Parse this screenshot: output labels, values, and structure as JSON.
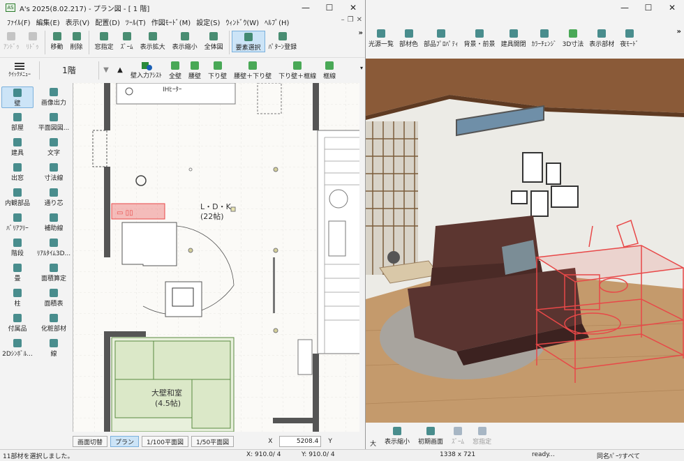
{
  "colors": {
    "accent": "#cce4f7",
    "selection": "#e84848",
    "wall": "#555555",
    "tatami": "#d9e8c8"
  },
  "win3d": {
    "toolbar": [
      {
        "label": "光源一覧",
        "icon": "lamp-icon"
      },
      {
        "label": "部材色",
        "icon": "palette-icon"
      },
      {
        "label": "部品ﾌﾟﾛﾊﾟﾃｨ",
        "icon": "property-icon"
      },
      {
        "label": "背景・前景",
        "icon": "background-icon"
      },
      {
        "label": "建具開閉",
        "icon": "door-open-icon"
      },
      {
        "label": "ｶﾗｰﾁｪﾝｼﾞ",
        "icon": "color-change-icon"
      },
      {
        "label": "3D寸法",
        "icon": "3d-dimension-icon"
      },
      {
        "label": "表示部材",
        "icon": "display-parts-icon"
      },
      {
        "label": "夜ﾓｰﾄﾞ",
        "icon": "night-mode-icon"
      }
    ],
    "bottom": [
      {
        "label": "大",
        "icon": ""
      },
      {
        "label": "表示縮小",
        "icon": "zoom-out-fit-icon"
      },
      {
        "label": "初期画面",
        "icon": "initial-view-icon"
      },
      {
        "label": "ｽﾞｰﾑ",
        "icon": "zoom-icon"
      },
      {
        "label": "窓指定",
        "icon": "window-zoom-icon"
      }
    ]
  },
  "win2d": {
    "title": "A's 2025(8.02.217) - プラン図 - [ 1 階]",
    "app_icon": "AS",
    "menu": [
      "ﾌｧｲﾙ(F)",
      "編集(E)",
      "表示(V)",
      "配置(D)",
      "ﾂｰﾙ(T)",
      "作図ﾓｰﾄﾞ(M)",
      "設定(S)",
      "ｳｨﾝﾄﾞｳ(W)",
      "ﾍﾙﾌﾟ(H)"
    ],
    "toolbar": [
      {
        "label": "ｱﾝﾄﾞｩ",
        "icon": "undo-icon",
        "state": "dis"
      },
      {
        "label": "ﾘﾄﾞｩ",
        "icon": "redo-icon",
        "state": "dis"
      },
      {
        "label": "移動",
        "icon": "move-icon",
        "state": ""
      },
      {
        "label": "削除",
        "icon": "eraser-icon",
        "state": ""
      },
      {
        "label": "窓指定",
        "icon": "window-select-icon",
        "state": ""
      },
      {
        "label": "ｽﾞｰﾑ",
        "icon": "zoom-icon",
        "state": ""
      },
      {
        "label": "表示拡大",
        "icon": "zoom-in-icon",
        "state": ""
      },
      {
        "label": "表示縮小",
        "icon": "zoom-out-icon",
        "state": ""
      },
      {
        "label": "全体図",
        "icon": "full-view-icon",
        "state": ""
      },
      {
        "label": "要素選択",
        "icon": "cursor-icon",
        "state": "sel"
      },
      {
        "label": "ﾊﾟﾀｰﾝ登録",
        "icon": "pattern-icon",
        "state": ""
      }
    ],
    "quick_menu": "ｸｲｯｸﾒﾆｭｰ",
    "floor": "1階",
    "wall_assist": "壁入力ｱｼｽﾄ",
    "wall_tools": [
      "全壁",
      "腰壁",
      "下り壁",
      "腰壁＋下り壁",
      "下り壁＋框線",
      "框線"
    ],
    "sidebar": [
      {
        "label": "壁",
        "icon": "wall-icon"
      },
      {
        "label": "画像出力",
        "icon": "image-output-icon"
      },
      {
        "label": "部屋",
        "icon": "room-icon"
      },
      {
        "label": "平面図図...",
        "icon": "plan-drawing-icon"
      },
      {
        "label": "建具",
        "icon": "door-icon"
      },
      {
        "label": "文字",
        "icon": "text-icon"
      },
      {
        "label": "出窓",
        "icon": "bay-window-icon"
      },
      {
        "label": "寸法線",
        "icon": "dimension-icon"
      },
      {
        "label": "内観部品",
        "icon": "interior-parts-icon"
      },
      {
        "label": "通り芯",
        "icon": "grid-axis-icon"
      },
      {
        "label": "ﾊﾞﾘｱﾌﾘｰ",
        "icon": "barrier-free-icon"
      },
      {
        "label": "補助線",
        "icon": "aux-line-icon"
      },
      {
        "label": "階段",
        "icon": "stairs-icon"
      },
      {
        "label": "ﾘｱﾙﾀｲﾑ3D...",
        "icon": "realtime-3d-icon"
      },
      {
        "label": "畳",
        "icon": "tatami-icon"
      },
      {
        "label": "面積算定",
        "icon": "area-calc-icon"
      },
      {
        "label": "柱",
        "icon": "column-icon"
      },
      {
        "label": "面積表",
        "icon": "area-table-icon"
      },
      {
        "label": "付属品",
        "icon": "accessory-icon"
      },
      {
        "label": "化粧部材",
        "icon": "trim-icon"
      },
      {
        "label": "2Dｼﾝﾎﾞﾙ...",
        "icon": "2d-symbol-icon"
      },
      {
        "label": "線",
        "icon": "line-icon"
      }
    ],
    "plan_labels": {
      "ih": "IHﾋｰﾀｰ",
      "ldk": "L・D・K",
      "ldk_size": "(22帖)",
      "washitsu": "大壁和室",
      "washitsu_size": "(4.5帖)"
    },
    "view_buttons": [
      "画面切替",
      "プラン",
      "1/100平面図",
      "1/50平面図"
    ],
    "coord_x_label": "X",
    "coord_x_value": "5208.4",
    "coord_y_label": "Y"
  },
  "status": {
    "message": "11部材を選択しました。",
    "x": "X: 910.0/ 4",
    "y": "Y: 910.0/ 4",
    "size": "1338 x 721",
    "ready": "ready...",
    "same": "同名ﾊﾟｰﾂすべて"
  }
}
